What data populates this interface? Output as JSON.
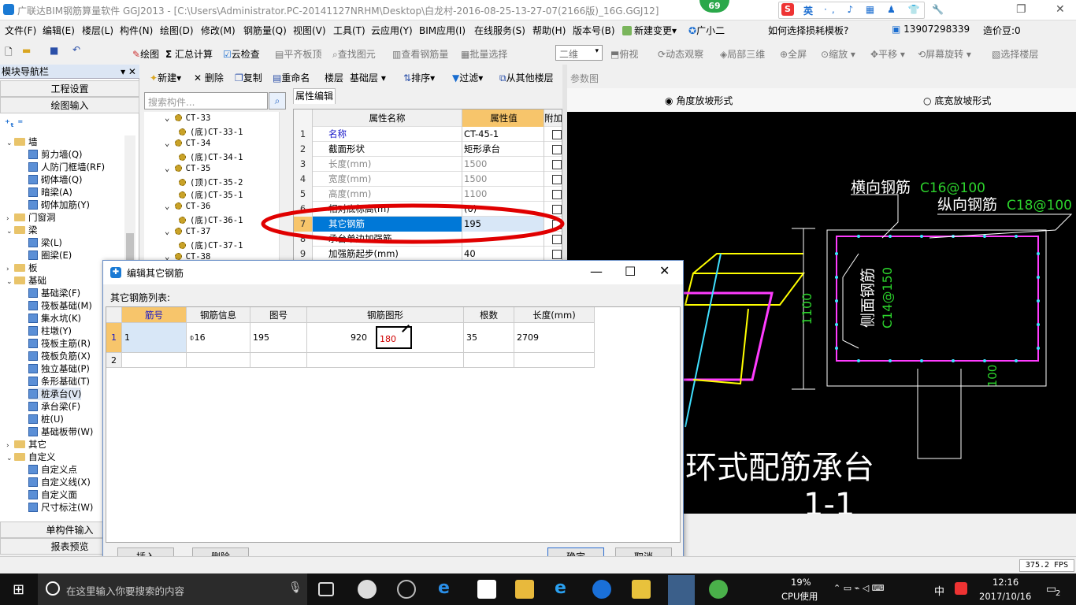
{
  "window": {
    "title": "广联达BIM钢筋算量软件 GGJ2013 - [C:\\Users\\Administrator.PC-20141127NRHM\\Desktop\\白龙村-2016-08-25-13-27-07(2166版)_16G.GGJ12]",
    "badge": "69",
    "ime_letter": "S",
    "ime_lang": "英",
    "ime_icons": "·, ♪ ▦ ♟ 👕 🔧"
  },
  "menu": {
    "items": [
      "文件(F)",
      "编辑(E)",
      "楼层(L)",
      "构件(N)",
      "绘图(D)",
      "修改(M)",
      "钢筋量(Q)",
      "视图(V)",
      "工具(T)",
      "云应用(Y)",
      "BIM应用(I)",
      "在线服务(S)",
      "帮助(H)",
      "版本号(B)",
      "新建变更",
      "广小二"
    ],
    "new_change_arrow": "▾",
    "help_link": "如何选择损耗模板?",
    "phone": "13907298339",
    "price": "造价豆:0"
  },
  "toolbar": {
    "draw": "绘图",
    "sum": "汇总计算",
    "cloud": "云检查",
    "flat": "平齐板顶",
    "find": "查找图元",
    "view_rebar": "查看钢筋量",
    "batch": "批量选择",
    "view_mode": "二维",
    "top_view": "俯视",
    "dynamic": "动态观察",
    "local3d": "局部三维",
    "fullscreen": "全屏",
    "zoom": "缩放",
    "pan": "平移",
    "rotate": "屏幕旋转",
    "select_floor": "选择楼层"
  },
  "nav": {
    "title": "模块导航栏",
    "pin": "▾ ✕",
    "project_settings": "工程设置",
    "draw_input": "绘图输入",
    "single_input": "单构件输入",
    "report": "报表预览",
    "tree": [
      {
        "label": "墙",
        "level": 0,
        "type": "folder",
        "open": true
      },
      {
        "label": "剪力墙(Q)",
        "level": 1
      },
      {
        "label": "人防门框墙(RF)",
        "level": 1
      },
      {
        "label": "砌体墙(Q)",
        "level": 1
      },
      {
        "label": "暗梁(A)",
        "level": 1
      },
      {
        "label": "砌体加筋(Y)",
        "level": 1
      },
      {
        "label": "门窗洞",
        "level": 0,
        "type": "folder",
        "open": false
      },
      {
        "label": "梁",
        "level": 0,
        "type": "folder",
        "open": true
      },
      {
        "label": "梁(L)",
        "level": 1
      },
      {
        "label": "圈梁(E)",
        "level": 1
      },
      {
        "label": "板",
        "level": 0,
        "type": "folder",
        "open": false
      },
      {
        "label": "基础",
        "level": 0,
        "type": "folder",
        "open": true
      },
      {
        "label": "基础梁(F)",
        "level": 1
      },
      {
        "label": "筏板基础(M)",
        "level": 1
      },
      {
        "label": "集水坑(K)",
        "level": 1
      },
      {
        "label": "柱墩(Y)",
        "level": 1
      },
      {
        "label": "筏板主筋(R)",
        "level": 1
      },
      {
        "label": "筏板负筋(X)",
        "level": 1
      },
      {
        "label": "独立基础(P)",
        "level": 1
      },
      {
        "label": "条形基础(T)",
        "level": 1
      },
      {
        "label": "桩承台(V)",
        "level": 1,
        "selected": true
      },
      {
        "label": "承台梁(F)",
        "level": 1
      },
      {
        "label": "桩(U)",
        "level": 1
      },
      {
        "label": "基础板带(W)",
        "level": 1
      },
      {
        "label": "其它",
        "level": 0,
        "type": "folder",
        "open": false
      },
      {
        "label": "自定义",
        "level": 0,
        "type": "folder",
        "open": true
      },
      {
        "label": "自定义点",
        "level": 1
      },
      {
        "label": "自定义线(X)",
        "level": 1
      },
      {
        "label": "自定义面",
        "level": 1
      },
      {
        "label": "尺寸标注(W)",
        "level": 1
      }
    ]
  },
  "components": {
    "new": "新建",
    "delete": "删除",
    "copy": "复制",
    "rename": "重命名",
    "floor": "楼层",
    "floor_value": "基础层",
    "sort": "排序",
    "filter": "过滤",
    "from_other": "从其他楼层",
    "search_placeholder": "搜索构件...",
    "tree": [
      {
        "label": "CT-33",
        "level": 0
      },
      {
        "label": "(底)CT-33-1",
        "level": 1
      },
      {
        "label": "CT-34",
        "level": 0
      },
      {
        "label": "(底)CT-34-1",
        "level": 1
      },
      {
        "label": "CT-35",
        "level": 0
      },
      {
        "label": "(顶)CT-35-2",
        "level": 1
      },
      {
        "label": "(底)CT-35-1",
        "level": 1
      },
      {
        "label": "CT-36",
        "level": 0
      },
      {
        "label": "(底)CT-36-1",
        "level": 1
      },
      {
        "label": "CT-37",
        "level": 0
      },
      {
        "label": "(底)CT-37-1",
        "level": 1
      },
      {
        "label": "CT-38",
        "level": 0
      }
    ]
  },
  "properties": {
    "tab": "属性编辑",
    "col_name": "属性名称",
    "col_value": "属性值",
    "col_extra": "附加",
    "rows": [
      {
        "n": "1",
        "k": "名称",
        "v": "CT-45-1",
        "style": "blue"
      },
      {
        "n": "2",
        "k": "截面形状",
        "v": "矩形承台",
        "style": ""
      },
      {
        "n": "3",
        "k": "长度(mm)",
        "v": "1500",
        "style": "grey"
      },
      {
        "n": "4",
        "k": "宽度(mm)",
        "v": "1500",
        "style": "grey"
      },
      {
        "n": "5",
        "k": "高度(mm)",
        "v": "1100",
        "style": "grey"
      },
      {
        "n": "6",
        "k": "相对底标高(m)",
        "v": "(0)",
        "style": ""
      },
      {
        "n": "7",
        "k": "其它钢筋",
        "v": "195",
        "style": "sel"
      },
      {
        "n": "8",
        "k": "承台单边加强筋",
        "v": "",
        "style": ""
      },
      {
        "n": "9",
        "k": "加强筋起步(mm)",
        "v": "40",
        "style": ""
      }
    ]
  },
  "param": {
    "title": "参数图",
    "opt1": "角度放坡形式",
    "opt2": "底宽放坡形式",
    "labels": {
      "horizontal": "横向钢筋",
      "horizontal_spec": "C16@100",
      "vertical": "纵向钢筋",
      "vertical_spec": "C18@100",
      "side": "侧面钢筋",
      "side_spec": "C14@150",
      "dim_h": "1100",
      "dim_b": "100",
      "caption": "环式配筋承台",
      "section": "1-1"
    }
  },
  "dialog": {
    "title": "编辑其它钢筋",
    "list_label": "其它钢筋列表:",
    "columns": [
      "筋号",
      "钢筋信息",
      "图号",
      "钢筋图形",
      "根数",
      "长度(mm)"
    ],
    "rows": [
      {
        "idx": "1",
        "id": "1",
        "info": "⌽16",
        "fig_no": "195",
        "shape_left": "920",
        "shape_inner": "180",
        "count": "35",
        "length": "2709"
      },
      {
        "idx": "2",
        "id": "",
        "info": "",
        "fig_no": "",
        "shape_left": "",
        "shape_inner": "",
        "count": "",
        "length": ""
      }
    ],
    "insert": "插入",
    "delete": "删除",
    "ok": "确定",
    "cancel": "取消"
  },
  "status": {
    "fps": "375.2 FPS"
  },
  "taskbar": {
    "search_placeholder": "在这里输入你要搜索的内容",
    "cpu_pct": "19%",
    "cpu_label": "CPU使用",
    "lang": "中",
    "time": "12:16",
    "date": "2017/10/16",
    "notif": "2"
  },
  "colors": {
    "selection": "#0078d7",
    "prop_header": "#f7c56b",
    "canvas": "#000000",
    "rebar_magenta": "#ff3cff",
    "rebar_yellow": "#ffff00",
    "dim_green": "#2cd22c",
    "taskbar": "#111111"
  }
}
